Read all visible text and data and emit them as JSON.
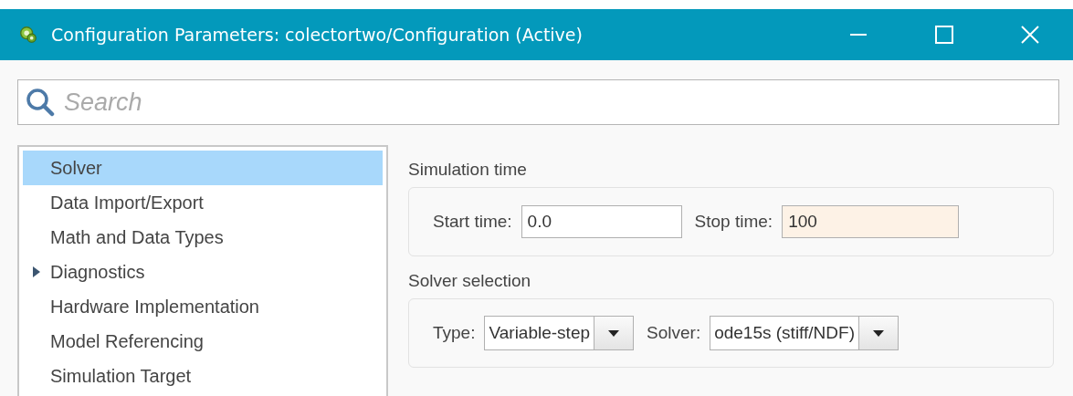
{
  "window": {
    "title": "Configuration Parameters: colectortwo/Configuration (Active)"
  },
  "search": {
    "placeholder": "Search"
  },
  "tree": {
    "items": [
      {
        "label": "Solver",
        "selected": true
      },
      {
        "label": "Data Import/Export",
        "selected": false
      },
      {
        "label": "Math and Data Types",
        "selected": false
      },
      {
        "label": "Diagnostics",
        "selected": false,
        "expanded": false
      },
      {
        "label": "Hardware Implementation",
        "selected": false
      },
      {
        "label": "Model Referencing",
        "selected": false
      },
      {
        "label": "Simulation Target",
        "selected": false
      }
    ]
  },
  "sections": [
    {
      "title": "Simulation time",
      "fields": [
        {
          "kind": "text",
          "label": "Start time:",
          "value": "0.0",
          "modified": false
        },
        {
          "kind": "text",
          "label": "Stop time:",
          "value": "100",
          "modified": true
        }
      ]
    },
    {
      "title": "Solver selection",
      "fields": [
        {
          "kind": "dropdown",
          "label": "Type:",
          "value": "Variable-step"
        },
        {
          "kind": "dropdown",
          "label": "Solver:",
          "value": "ode15s (stiff/NDF)"
        }
      ]
    }
  ]
}
